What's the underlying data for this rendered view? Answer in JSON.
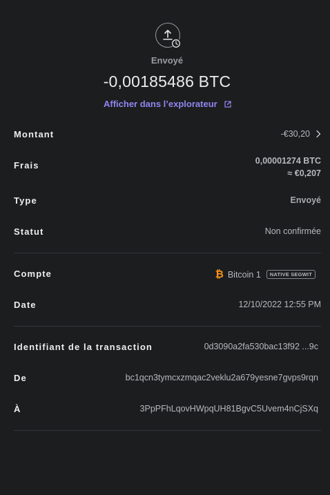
{
  "header": {
    "status": "Envoyé",
    "amount": "-0,00185486 BTC",
    "explorer_link": "Afficher dans l’explorateur"
  },
  "icons": {
    "operation": "upload-icon",
    "pending": "clock-icon",
    "external": "external-link-icon",
    "chevron": "chevron-right-icon",
    "currency": "bitcoin-icon"
  },
  "details": {
    "amount_label": "Montant",
    "amount_value": "-€30,20",
    "fees_label": "Frais",
    "fees_value": "0,00001274 BTC",
    "fees_fiat": "≈ €0,207",
    "type_label": "Type",
    "type_value": "Envoyé",
    "status_label": "Statut",
    "status_value": "Non confirmée",
    "account_label": "Compte",
    "account_glyph": "₿",
    "account_value": "Bitcoin 1",
    "account_badge": "NATIVE SEGWIT",
    "date_label": "Date",
    "date_value": "12/10/2022 12:55 PM",
    "txid_label": "Identifiant de la transaction",
    "txid_value": "0d3090a2fa530bac13f92 ...9c",
    "from_label": "De",
    "from_value": "bc1qcn3tymcxzmqac2veklu2a679yesne7gvps9rqn",
    "to_label": "À",
    "to_value": "3PpPFhLqovHWpqUH81BgvC5Uvem4nCjSXq"
  },
  "colors": {
    "background": "#1c1d1f",
    "accent": "#8f86ef",
    "bitcoin": "#f7931a"
  }
}
